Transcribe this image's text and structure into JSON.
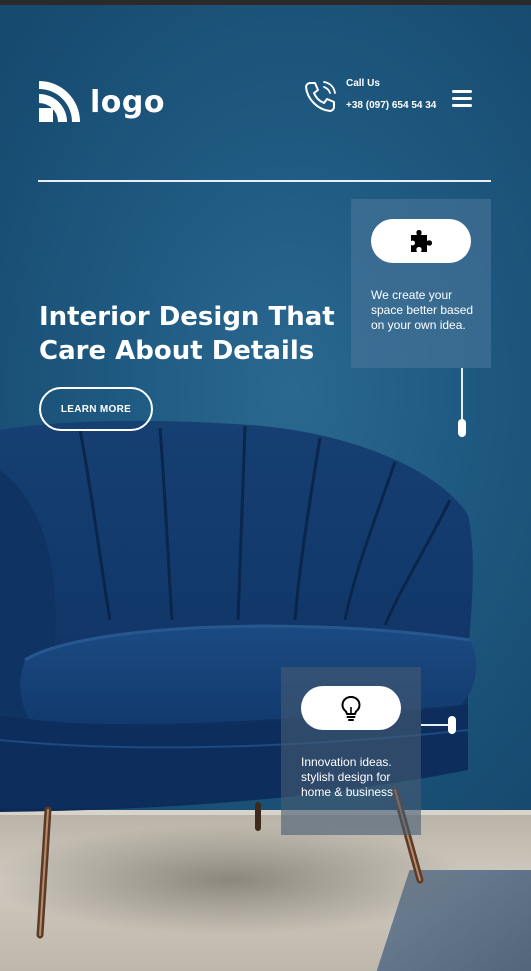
{
  "brand": {
    "logo_text": "logo"
  },
  "header": {
    "call_label": "Call Us",
    "phone_number": "+38 (097) 654 54 34",
    "menu_icon": "hamburger-menu-icon",
    "phone_icon": "phone-icon"
  },
  "hero": {
    "headline_line1": "Interior Design That",
    "headline_line2": "Care About Details",
    "cta_label": "LEARN MORE"
  },
  "features": [
    {
      "icon": "puzzle-piece-icon",
      "text": "We create your space better based on your own idea."
    },
    {
      "icon": "lightbulb-icon",
      "text": "Innovation ideas. stylish design for home & business"
    }
  ],
  "colors": {
    "background": "#1f5a82",
    "accent": "#ffffff",
    "text": "#ffffff"
  }
}
